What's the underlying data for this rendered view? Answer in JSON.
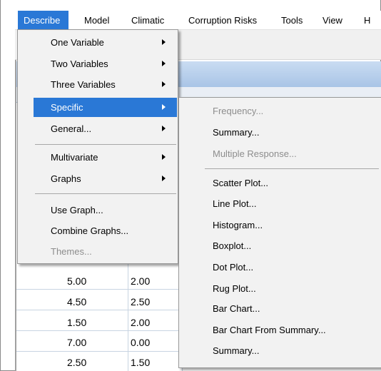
{
  "menubar": {
    "items": [
      {
        "label": "Describe",
        "active": true
      },
      {
        "label": "Model"
      },
      {
        "label": "Climatic"
      },
      {
        "label": "Corruption Risks"
      },
      {
        "label": "Tools"
      },
      {
        "label": "View"
      },
      {
        "label": "H"
      }
    ]
  },
  "describe_menu": {
    "items": [
      {
        "label": "One Variable",
        "has_submenu": true
      },
      {
        "label": "Two Variables",
        "has_submenu": true
      },
      {
        "label": "Three Variables",
        "has_submenu": true
      },
      {
        "label": "Specific",
        "has_submenu": true,
        "highlighted": true
      },
      {
        "label": "General...",
        "has_submenu": true
      },
      {
        "label": "Multivariate",
        "has_submenu": true
      },
      {
        "label": "Graphs",
        "has_submenu": true
      },
      {
        "label": "Use Graph..."
      },
      {
        "label": "Combine Graphs..."
      },
      {
        "label": "Themes...",
        "disabled": true
      }
    ]
  },
  "specific_submenu": {
    "items": [
      {
        "label": "Frequency...",
        "disabled": true
      },
      {
        "label": "Summary..."
      },
      {
        "label": "Multiple Response...",
        "disabled": true
      },
      {
        "label": "Scatter Plot..."
      },
      {
        "label": "Line Plot..."
      },
      {
        "label": "Histogram..."
      },
      {
        "label": "Boxplot..."
      },
      {
        "label": "Dot Plot..."
      },
      {
        "label": "Rug Plot..."
      },
      {
        "label": "Bar Chart..."
      },
      {
        "label": "Bar Chart From Summary..."
      },
      {
        "label": "Summary..."
      }
    ]
  },
  "grid": {
    "rows": [
      [
        "5.00",
        "2.00"
      ],
      [
        "4.50",
        "2.50"
      ],
      [
        "1.50",
        "2.00"
      ],
      [
        "7.00",
        "0.00"
      ],
      [
        "2.50",
        "1.50"
      ]
    ]
  },
  "colors": {
    "highlight": "#2a78d6",
    "menu_bg": "#f2f2f2",
    "disabled_text": "#8d8d8d"
  }
}
